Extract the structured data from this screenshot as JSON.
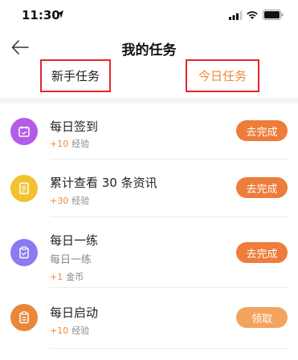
{
  "status_bar": {
    "time": "11:30"
  },
  "header": {
    "title": "我的任务"
  },
  "tabs": [
    {
      "label": "新手任务"
    },
    {
      "label": "今日任务"
    }
  ],
  "colors": {
    "accent": "#ee7c3a",
    "claim_button": "#f4a35f",
    "highlight_border": "#e6262b",
    "reward_text": "#f08a3a"
  },
  "tasks": [
    {
      "icon": "calendar-icon",
      "icon_color": "#b35ce8",
      "title": "每日签到",
      "reward_amount": "+10",
      "reward_unit": "经验",
      "button": "去完成"
    },
    {
      "icon": "document-icon",
      "icon_color": "#f2c12e",
      "title": "累计查看 30 条资讯",
      "reward_amount": "+30",
      "reward_unit": "经验",
      "button": "去完成"
    },
    {
      "icon": "clipboard-check-icon",
      "icon_color": "#8a7cf0",
      "title": "每日一练",
      "subtitle": "每日一练",
      "reward_amount": "+1",
      "reward_unit": "金币",
      "button": "去完成"
    },
    {
      "icon": "clipboard-icon",
      "icon_color": "#e8873a",
      "title": "每日启动",
      "reward_amount": "+10",
      "reward_unit": "经验",
      "button": "领取"
    }
  ]
}
